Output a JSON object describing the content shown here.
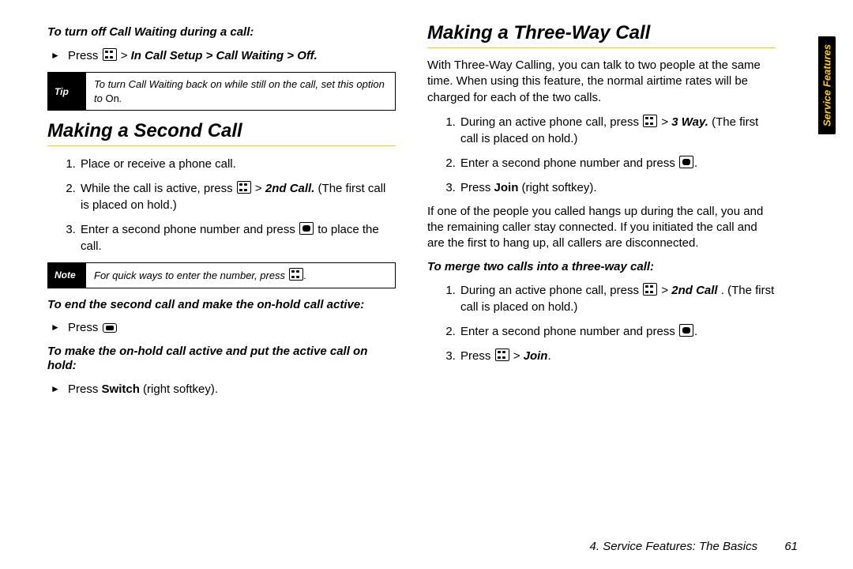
{
  "sidetab": "Service Features",
  "footer": {
    "chapter": "4. Service Features: The Basics",
    "page": "61"
  },
  "left": {
    "intro_sub": "To turn off Call Waiting during a call:",
    "intro_bullet_prefix": "Press ",
    "intro_bullet_path": "In Call Setup > Call Waiting > Off.",
    "tip_label": "Tip",
    "tip_text": "To turn Call Waiting back on while still on the call, set this option to ",
    "tip_on": "On",
    "heading": "Making a Second Call",
    "steps": {
      "s1": "Place or receive a phone call.",
      "s2a": "While the call is active, press ",
      "s2b": "2nd Call.",
      "s2c": " (The first call is placed on hold.)",
      "s3a": "Enter a second phone number and press ",
      "s3b": " to place the call."
    },
    "note_label": "Note",
    "note_text": "For quick ways to enter the number, press ",
    "sub2": "To end the second call and make the on-hold call active:",
    "b2": "Press ",
    "sub3": "To make the on-hold call active and put the active call on hold:",
    "b3a": "Press ",
    "b3b": "Switch",
    "b3c": " (right softkey)."
  },
  "right": {
    "heading": "Making a Three-Way Call",
    "para": "With Three-Way Calling, you can talk to two people at the same time. When using this feature, the normal airtime rates will be charged for each of the two calls.",
    "steps": {
      "s1a": "During an active phone call, press ",
      "s1b": "3 Way.",
      "s1c": " (The first call is placed on hold.)",
      "s2": "Enter a second phone number and press ",
      "s2end": ".",
      "s3a": "Press ",
      "s3b": "Join",
      "s3c": " (right softkey)."
    },
    "para2": "If one of the people you called hangs up during the call, you and the remaining caller stay connected. If you initiated the call and are the first to hang up, all callers are disconnected.",
    "sub": "To merge two calls into a three-way call:",
    "merge": {
      "s1a": "During an active phone call, press ",
      "s1b": "2nd Call",
      "s1c": ". (The first call is placed on hold.)",
      "s2": "Enter a second phone number and press ",
      "s2end": ".",
      "s3a": "Press ",
      "s3b": "Join",
      "s3c": "."
    }
  }
}
